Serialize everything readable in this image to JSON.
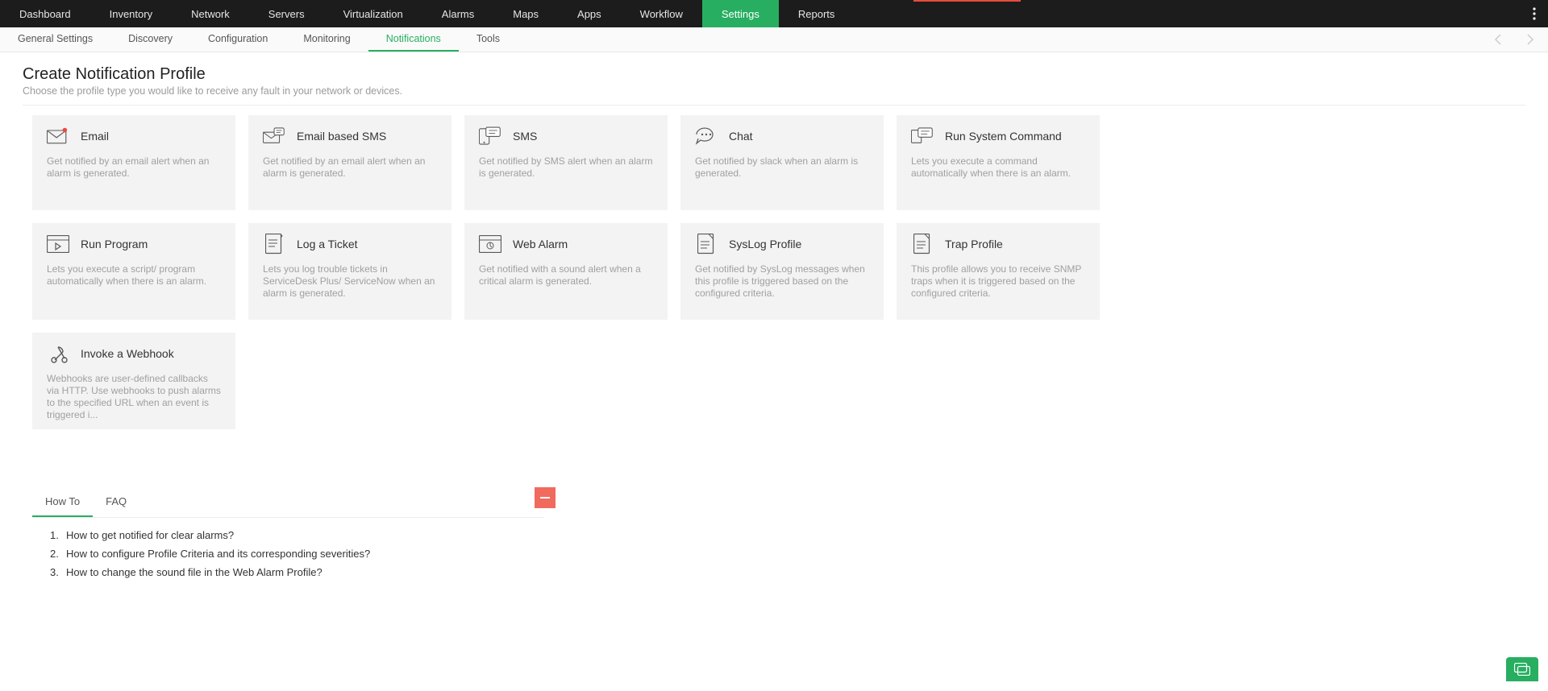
{
  "topnav": [
    "Dashboard",
    "Inventory",
    "Network",
    "Servers",
    "Virtualization",
    "Alarms",
    "Maps",
    "Apps",
    "Workflow",
    "Settings",
    "Reports"
  ],
  "topnav_active_index": 9,
  "subnav": [
    "General Settings",
    "Discovery",
    "Configuration",
    "Monitoring",
    "Notifications",
    "Tools"
  ],
  "subnav_active_index": 4,
  "page": {
    "title": "Create Notification Profile",
    "subtitle": "Choose the profile type you would like to receive any fault in your network or devices."
  },
  "cards": [
    {
      "icon": "email",
      "title": "Email",
      "desc": "Get notified by an email alert when an alarm is generated."
    },
    {
      "icon": "email-sms",
      "title": "Email based SMS",
      "desc": "Get notified by an email alert when an alarm is generated."
    },
    {
      "icon": "sms",
      "title": "SMS",
      "desc": "Get notified by SMS alert when an alarm is generated."
    },
    {
      "icon": "chat",
      "title": "Chat",
      "desc": "Get notified by slack when an alarm is generated."
    },
    {
      "icon": "command",
      "title": "Run System Command",
      "desc": "Lets you execute a command automatically when there is an alarm."
    },
    {
      "icon": "program",
      "title": "Run Program",
      "desc": "Lets you execute a script/ program automatically when there is an alarm."
    },
    {
      "icon": "ticket",
      "title": "Log a Ticket",
      "desc": "Lets you log trouble tickets in ServiceDesk Plus/ ServiceNow when an alarm is generated."
    },
    {
      "icon": "webalarm",
      "title": "Web Alarm",
      "desc": "Get notified with a sound alert when a critical alarm is generated."
    },
    {
      "icon": "syslog",
      "title": "SysLog Profile",
      "desc": "Get notified by SysLog messages when this profile is triggered based on the configured criteria."
    },
    {
      "icon": "trap",
      "title": "Trap Profile",
      "desc": "This profile allows you to receive SNMP traps when it is triggered based on the configured criteria."
    },
    {
      "icon": "webhook",
      "title": "Invoke a Webhook",
      "desc": "Webhooks are user-defined callbacks via HTTP. Use webhooks to push alarms to the specified URL when an event is triggered i..."
    }
  ],
  "howto": {
    "tabs": [
      "How To",
      "FAQ"
    ],
    "active_tab": 0,
    "items": [
      "How to get notified for clear alarms?",
      "How to configure Profile Criteria and its corresponding severities?",
      "How to change the sound file in the Web Alarm Profile?"
    ]
  }
}
